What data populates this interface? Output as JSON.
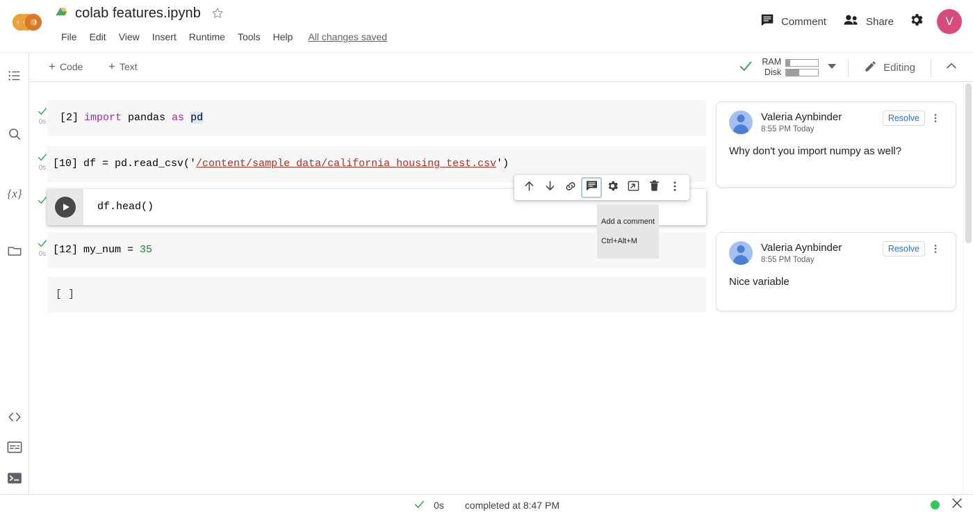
{
  "header": {
    "logo_name": "colab-logo",
    "drive_icon": "drive-icon",
    "doc_title": "colab features.ipynb",
    "star_icon": "star-icon",
    "menu_items": [
      "File",
      "Edit",
      "View",
      "Insert",
      "Runtime",
      "Tools",
      "Help"
    ],
    "save_status": "All changes saved",
    "comment_label": "Comment",
    "share_label": "Share",
    "settings_icon": "gear-icon",
    "avatar_initial": "V",
    "avatar_color": "#d94b78"
  },
  "sidebar": {
    "items": [
      {
        "name": "table-of-contents-icon",
        "label": "Table of contents"
      },
      {
        "name": "search-icon",
        "label": "Find and replace"
      },
      {
        "name": "variables-icon",
        "label": "Variables"
      },
      {
        "name": "files-icon",
        "label": "Files"
      }
    ],
    "bottom_items": [
      {
        "name": "code-snippets-icon",
        "label": "Code snippets"
      },
      {
        "name": "command-palette-icon",
        "label": "Command palette"
      },
      {
        "name": "terminal-icon",
        "label": "Terminal"
      }
    ]
  },
  "toolbar": {
    "add_code_label": "Code",
    "add_text_label": "Text",
    "plus": "+",
    "connected_check_icon": "check-icon",
    "ram_label": "RAM",
    "disk_label": "Disk",
    "ram_percent": 13,
    "disk_percent": 42,
    "dropdown_icon": "chevron-down-icon",
    "editing_label": "Editing",
    "pencil_icon": "pencil-icon",
    "collapse_icon": "chevron-up-icon"
  },
  "notebook": {
    "cells": [
      {
        "id": "cell-import-pandas",
        "prompt": "[2]",
        "status_icon": "check-icon",
        "exec_time": "0s",
        "tokens": [
          {
            "text": "import ",
            "style": "kw"
          },
          {
            "text": "pandas ",
            "style": "plain"
          },
          {
            "text": "as ",
            "style": "kw"
          },
          {
            "text": "pd",
            "style": "hl"
          }
        ]
      },
      {
        "id": "cell-read-csv",
        "prompt": "[10]",
        "status_icon": "check-icon",
        "exec_time": "0s",
        "tokens": [
          {
            "text": "df = pd.read_csv('",
            "style": "plain"
          },
          {
            "text": "/content/sample_data/california_housing_test.csv",
            "style": "str-link"
          },
          {
            "text": "')",
            "style": "plain"
          }
        ]
      },
      {
        "id": "cell-df-head",
        "prompt": "",
        "status_icon": "check-icon",
        "exec_time": "",
        "active": true,
        "run_button": "run-cell-button",
        "tokens": [
          {
            "text": "df.head()",
            "style": "plain"
          }
        ]
      },
      {
        "id": "cell-my-num",
        "prompt": "[12]",
        "status_icon": "check-icon",
        "exec_time": "0s",
        "tokens": [
          {
            "text": "my_num = ",
            "style": "plain"
          },
          {
            "text": "35",
            "style": "num"
          }
        ]
      },
      {
        "id": "cell-empty",
        "prompt": "[ ]",
        "status_icon": "",
        "exec_time": "",
        "tokens": []
      }
    ]
  },
  "cell_toolbar": {
    "buttons": [
      {
        "name": "move-cell-up-icon",
        "label": "Move cell up"
      },
      {
        "name": "move-cell-down-icon",
        "label": "Move cell down"
      },
      {
        "name": "link-to-cell-icon",
        "label": "Link to cell"
      },
      {
        "name": "add-comment-icon",
        "label": "Add a comment",
        "focused": true
      },
      {
        "name": "cell-settings-icon",
        "label": "Cell settings"
      },
      {
        "name": "mirror-cell-in-tab-icon",
        "label": "Mirror cell in tab"
      },
      {
        "name": "delete-cell-icon",
        "label": "Delete cell"
      },
      {
        "name": "more-cell-actions-icon",
        "label": "More cell actions"
      }
    ],
    "tooltip_title": "Add a comment",
    "tooltip_shortcut": "Ctrl+Alt+M"
  },
  "comments": [
    {
      "id": "comment-1",
      "author": "Valeria Aynbinder",
      "timestamp": "8:55 PM Today",
      "resolve_label": "Resolve",
      "more_icon": "more-vert-icon",
      "text": "Why don't you import numpy as well?"
    },
    {
      "id": "comment-2",
      "author": "Valeria Aynbinder",
      "timestamp": "8:55 PM Today",
      "resolve_label": "Resolve",
      "more_icon": "more-vert-icon",
      "text": "Nice variable"
    }
  ],
  "bottombar": {
    "status_icon": "check-icon",
    "exec_time": "0s",
    "status_text": "completed at 8:47 PM",
    "indicator_color": "#34c759",
    "close_icon": "close-icon"
  }
}
